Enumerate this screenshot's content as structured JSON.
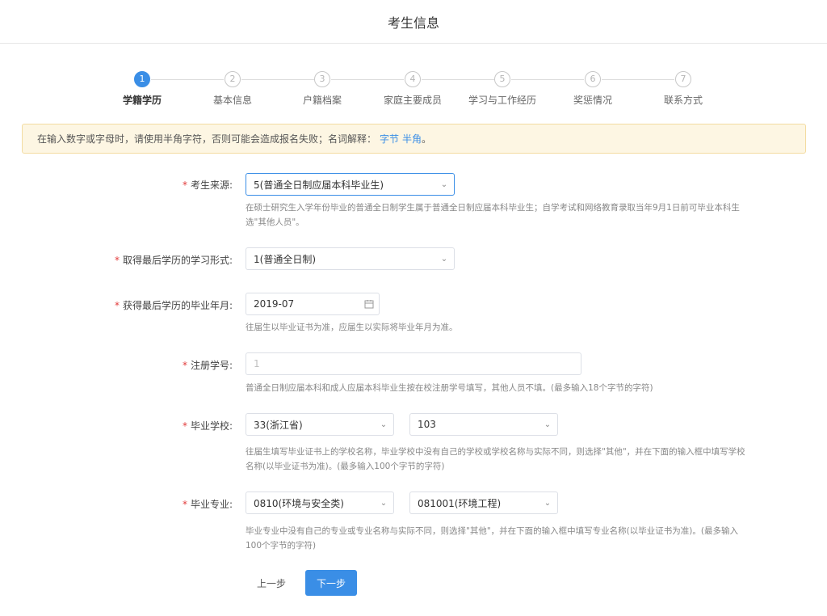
{
  "header": {
    "title": "考生信息"
  },
  "steps": [
    {
      "num": "1",
      "label": "学籍学历",
      "active": true
    },
    {
      "num": "2",
      "label": "基本信息"
    },
    {
      "num": "3",
      "label": "户籍档案"
    },
    {
      "num": "4",
      "label": "家庭主要成员"
    },
    {
      "num": "5",
      "label": "学习与工作经历"
    },
    {
      "num": "6",
      "label": "奖惩情况"
    },
    {
      "num": "7",
      "label": "联系方式"
    }
  ],
  "notice": {
    "text": "在输入数字或字母时，请使用半角字符，否则可能会造成报名失败；名词解释：",
    "link1": "字节",
    "link2": "半角",
    "tail": "。"
  },
  "form": {
    "source": {
      "label": "考生来源:",
      "value": "5(普通全日制应届本科毕业生)",
      "hint": "在硕士研究生入学年份毕业的普通全日制学生属于普通全日制应届本科毕业生；自学考试和网络教育录取当年9月1日前可毕业本科生选\"其他人员\"。"
    },
    "study_form": {
      "label": "取得最后学历的学习形式:",
      "value": "1(普通全日制)"
    },
    "grad_date": {
      "label": "获得最后学历的毕业年月:",
      "value": "2019-07",
      "hint": "往届生以毕业证书为准，应届生以实际将毕业年月为准。"
    },
    "reg_no": {
      "label": "注册学号:",
      "value": "1",
      "hint": "普通全日制应届本科和成人应届本科毕业生按在校注册学号填写，其他人员不填。(最多输入18个字节的字符)"
    },
    "school": {
      "label": "毕业学校:",
      "province": "33(浙江省)",
      "school": "103",
      "hint": "往届生填写毕业证书上的学校名称，毕业学校中没有自己的学校或学校名称与实际不同，则选择\"其他\"，并在下面的输入框中填写学校名称(以毕业证书为准)。(最多输入100个字节的字符)"
    },
    "major": {
      "label": "毕业专业:",
      "category": "0810(环境与安全类)",
      "major": "081001(环境工程)",
      "hint": "毕业专业中没有自己的专业或专业名称与实际不同，则选择\"其他\"，并在下面的输入框中填写专业名称(以毕业证书为准)。(最多输入100个字节的字符)"
    }
  },
  "buttons": {
    "prev": "上一步",
    "next": "下一步"
  },
  "colors": {
    "accent": "#3a8ee6",
    "required": "#e23b3b",
    "notice_bg": "#fdf6e3"
  }
}
